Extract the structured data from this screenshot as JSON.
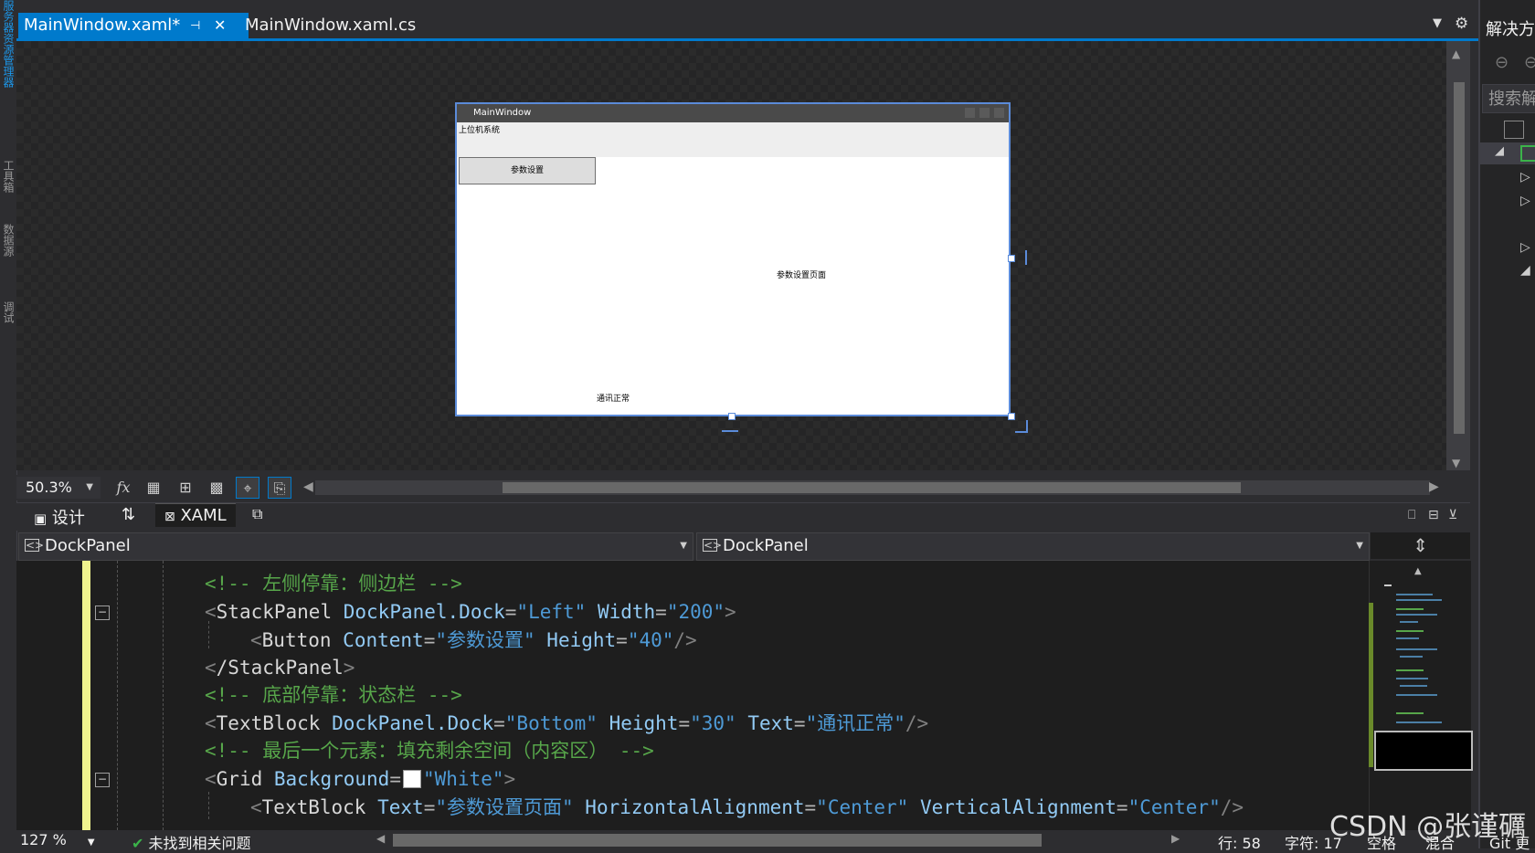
{
  "left_strip": {
    "items": [
      "服务器资源管理器",
      "工具箱",
      "数据源",
      "调试"
    ]
  },
  "tabs": [
    {
      "label": "MainWindow.xaml*",
      "active": true,
      "pin_icon": "pin-icon",
      "close_icon": "close-icon"
    },
    {
      "label": "MainWindow.xaml.cs",
      "active": false
    }
  ],
  "tab_controls": {
    "dropdown_icon": "chevron-down-icon",
    "settings_icon": "gear-icon"
  },
  "preview_window": {
    "title": "MainWindow",
    "header_text": "上位机系统",
    "button_label": "参数设置",
    "content_text": "参数设置页面",
    "status_text": "通讯正常"
  },
  "designer_toolbar": {
    "zoom": "50.3%",
    "fx": "fx"
  },
  "split_bar": {
    "design_label": "设计",
    "swap_icon": "swap-icon",
    "xaml_label": "XAML"
  },
  "dropdowns": {
    "left": "DockPanel",
    "right": "DockPanel"
  },
  "code": {
    "lines": [
      {
        "comment": "<!-- 左侧停靠：侧边栏 -->"
      },
      {
        "tag": "StackPanel",
        "attrs": "DockPanel.Dock=\"Left\" Width=\"200\""
      },
      {
        "tag": "Button",
        "attrs": "Content=\"参数设置\" Height=\"40\""
      },
      {
        "tag": "/StackPanel"
      },
      {
        "comment": "<!-- 底部停靠：状态栏 -->"
      },
      {
        "tag": "TextBlock",
        "attrs": "DockPanel.Dock=\"Bottom\" Height=\"30\" Text=\"通讯正常\""
      },
      {
        "comment": "<!-- 最后一个元素：填充剩余空间（内容区） -->"
      },
      {
        "tag": "Grid",
        "attrs": "Background=\"White\""
      },
      {
        "tag": "TextBlock",
        "attrs": "Text=\"参数设置页面\" HorizontalAlignment=\"Center\" VerticalAlignment=\"Center\""
      }
    ]
  },
  "status": {
    "zoom": "127 %",
    "issues": "未找到相关问题",
    "line": "行: 58",
    "char": "字符: 17",
    "space": "空格",
    "mixed": "混合",
    "git": "Git 更"
  },
  "solution_explorer": {
    "title": "解决方",
    "search_placeholder": "搜索解"
  },
  "watermark": "CSDN @张谨礪"
}
